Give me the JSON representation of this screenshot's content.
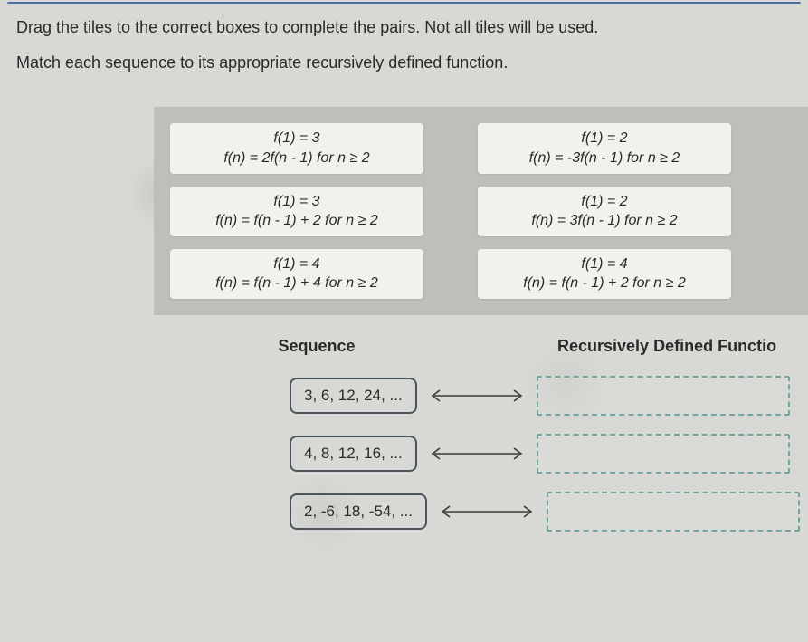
{
  "instructions": {
    "line1": "Drag the tiles to the correct boxes to complete the pairs. Not all tiles will be used.",
    "line2": "Match each sequence to its appropriate recursively defined function."
  },
  "tiles": [
    {
      "line1": "f(1) = 3",
      "line2": "f(n) = 2f(n - 1) for n ≥ 2"
    },
    {
      "line1": "f(1) = 2",
      "line2": "f(n) = -3f(n - 1) for n ≥ 2"
    },
    {
      "line1": "f(1) = 3",
      "line2": "f(n) = f(n - 1) + 2 for n ≥ 2"
    },
    {
      "line1": "f(1) = 2",
      "line2": "f(n) = 3f(n - 1) for n ≥ 2"
    },
    {
      "line1": "f(1) = 4",
      "line2": "f(n) = f(n - 1) + 4 for n ≥ 2"
    },
    {
      "line1": "f(1) = 4",
      "line2": "f(n) = f(n - 1) + 2 for n ≥ 2"
    }
  ],
  "headers": {
    "sequence": "Sequence",
    "function": "Recursively Defined Functio"
  },
  "sequences": [
    "3, 6, 12, 24, ...",
    "4, 8, 12, 16, ...",
    "2, -6, 18, -54, ..."
  ]
}
